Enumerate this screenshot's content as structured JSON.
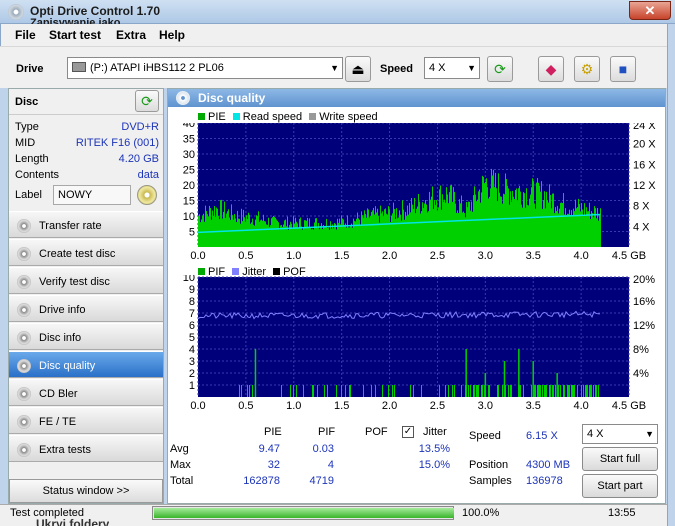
{
  "window": {
    "title": "Opti Drive Control 1.70",
    "subtitle": "Zapisywanie jako",
    "close_glyph": "✕"
  },
  "menu": [
    "File",
    "Start test",
    "Extra",
    "Help"
  ],
  "toolbar": {
    "drive_label": "Drive",
    "drive_value": "(P:)   ATAPI iHBS112   2 PL06",
    "speed_label": "Speed",
    "speed_value": "4 X"
  },
  "disc": {
    "heading": "Disc",
    "rows": [
      {
        "k": "Type",
        "v": "DVD+R"
      },
      {
        "k": "MID",
        "v": "RITEK F16 (001)"
      },
      {
        "k": "Length",
        "v": "4.20 GB"
      },
      {
        "k": "Contents",
        "v": "data"
      }
    ],
    "label_key": "Label",
    "label_value": "NOWY"
  },
  "nav": [
    {
      "label": "Transfer rate",
      "icon": "disc-icon"
    },
    {
      "label": "Create test disc",
      "icon": "disc-icon"
    },
    {
      "label": "Verify test disc",
      "icon": "disc-icon"
    },
    {
      "label": "Drive info",
      "icon": "disc-icon"
    },
    {
      "label": "Disc info",
      "icon": "disc-icon"
    },
    {
      "label": "Disc quality",
      "icon": "disc-icon",
      "active": true
    },
    {
      "label": "CD Bler",
      "icon": "disc-icon"
    },
    {
      "label": "FE / TE",
      "icon": "disc-icon"
    },
    {
      "label": "Extra tests",
      "icon": "disc-icon"
    }
  ],
  "status_window_label": "Status window >>",
  "panel_title": "Disc quality",
  "chart_data": [
    {
      "type": "area",
      "legend": [
        "PIE",
        "Read speed",
        "Write speed"
      ],
      "colors": {
        "PIE": "#00dd00",
        "Read speed": "#00e5e5",
        "Write speed": "#999999"
      },
      "xlim": [
        0,
        4.5
      ],
      "x_ticks": [
        "0.0",
        "0.5",
        "1.0",
        "1.5",
        "2.0",
        "2.5",
        "3.0",
        "3.5",
        "4.0",
        "4.5 GB"
      ],
      "ylim": [
        0,
        40
      ],
      "y_ticks": [
        "40",
        "35",
        "30",
        "25",
        "20",
        "15",
        "10",
        "5"
      ],
      "y2_ticks": [
        "24 X",
        "20 X",
        "16 X",
        "12 X",
        "8 X",
        "4 X"
      ],
      "pie_envelope": {
        "x": [
          0.0,
          0.2,
          0.4,
          0.6,
          0.8,
          1.0,
          1.2,
          1.4,
          1.6,
          1.8,
          2.0,
          2.2,
          2.4,
          2.6,
          2.8,
          3.0,
          3.2,
          3.4,
          3.6,
          3.8,
          4.0,
          4.2
        ],
        "y": [
          13,
          16,
          13,
          12,
          10,
          10,
          10,
          10,
          11,
          13,
          14,
          16,
          20,
          22,
          15,
          27,
          24,
          23,
          22,
          18,
          16,
          14
        ]
      },
      "read_speed": {
        "x": [
          0.0,
          4.2
        ],
        "y": [
          4.7,
          10.5
        ]
      }
    },
    {
      "type": "bar",
      "legend": [
        "PIF",
        "Jitter",
        "POF"
      ],
      "colors": {
        "PIF": "#00dd00",
        "Jitter": "#8080ff",
        "POF": "#000000"
      },
      "xlim": [
        0,
        4.5
      ],
      "x_ticks": [
        "0.0",
        "0.5",
        "1.0",
        "1.5",
        "2.0",
        "2.5",
        "3.0",
        "3.5",
        "4.0",
        "4.5 GB"
      ],
      "ylim": [
        0,
        10
      ],
      "y_ticks": [
        "10",
        "9",
        "8",
        "7",
        "6",
        "5",
        "4",
        "3",
        "2",
        "1"
      ],
      "y2_ticks": [
        "20%",
        "16%",
        "12%",
        "8%",
        "4%"
      ],
      "jitter_percent": {
        "x": [
          0.0,
          4.2
        ],
        "y": [
          13.5,
          13.8
        ]
      },
      "pif_peaks": {
        "x": [
          0.6,
          2.8,
          3.0,
          3.2,
          3.35,
          3.5,
          3.75
        ],
        "y": [
          4,
          4,
          2,
          3,
          4,
          3,
          2
        ]
      }
    }
  ],
  "stats": {
    "headers": [
      "PIE",
      "PIF",
      "POF",
      "Jitter"
    ],
    "jitter_checked": true,
    "rows": [
      {
        "label": "Avg",
        "pie": "9.47",
        "pif": "0.03",
        "pof": "",
        "jitter": "13.5%"
      },
      {
        "label": "Max",
        "pie": "32",
        "pif": "4",
        "pof": "",
        "jitter": "15.0%"
      },
      {
        "label": "Total",
        "pie": "162878",
        "pif": "4719",
        "pof": "",
        "jitter": ""
      }
    ],
    "speed_label": "Speed",
    "speed_value": "6.15 X",
    "position_label": "Position",
    "position_value": "4300 MB",
    "samples_label": "Samples",
    "samples_value": "136978",
    "speed_select": "4 X",
    "start_full": "Start full",
    "start_part": "Start part"
  },
  "statusbar": {
    "text": "Test completed",
    "behind_text": "Ukryj foldery",
    "progress": 1.0,
    "progress_text": "100.0%",
    "time": "13:55"
  }
}
